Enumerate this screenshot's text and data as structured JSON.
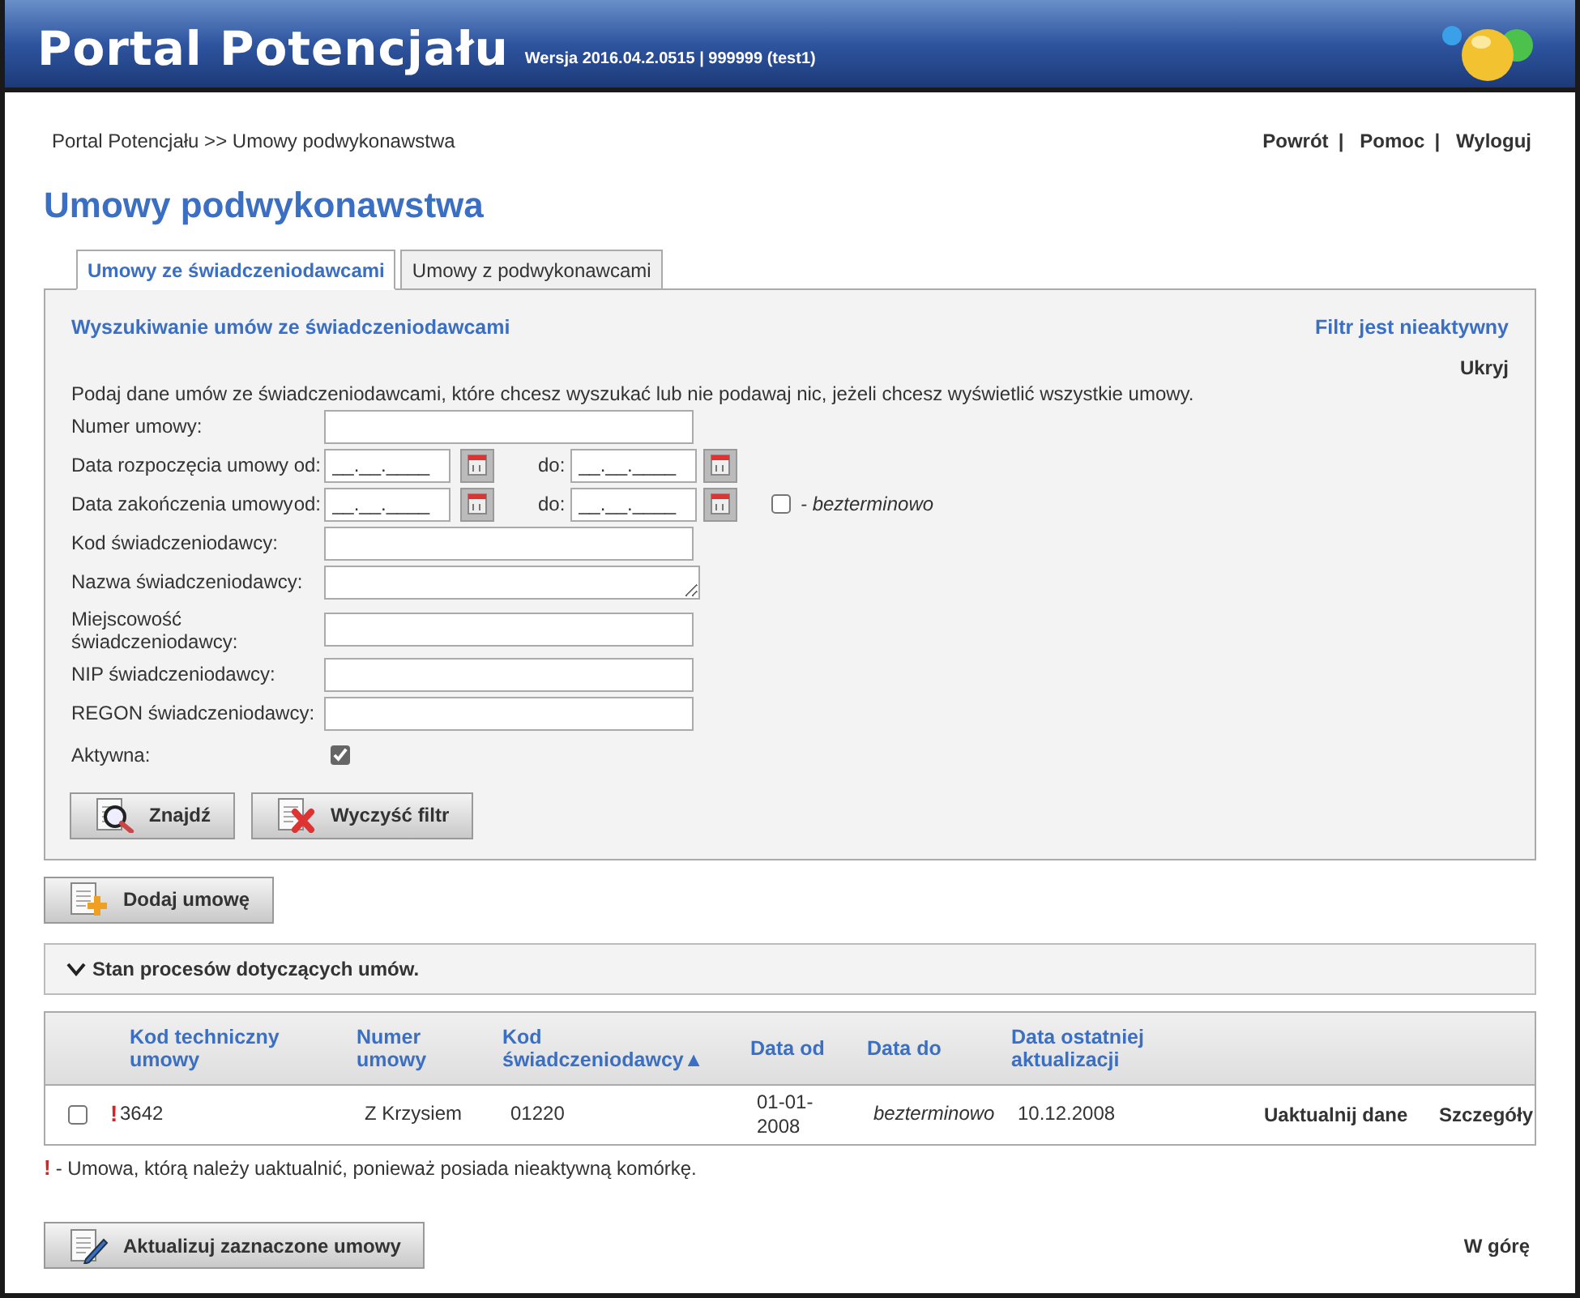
{
  "header": {
    "title": "Portal Potencjału",
    "version": "Wersja 2016.04.2.0515 | 999999 (test1)"
  },
  "breadcrumb": "Portal Potencjału >> Umowy podwykonawstwa",
  "top_links": [
    {
      "label": "Powrót",
      "separator": "|"
    },
    {
      "label": "Pomoc",
      "separator": "|"
    },
    {
      "label": "Wyloguj"
    }
  ],
  "page_title": "Umowy podwykonawstwa",
  "tabs": [
    {
      "label": "Umowy ze świadczeniodawcami",
      "selected": true
    },
    {
      "label": "Umowy z podwykonawcami",
      "selected": false
    }
  ],
  "filter": {
    "title": "Wyszukiwanie umów ze świadczeniodawcami",
    "status": "Filtr jest nieaktywny",
    "hide_link": "Ukryj",
    "instructions": "Podaj dane umów ze świadczeniodawcami, które chcesz wyszukać lub nie podawaj nic, jeżeli chcesz wyświetlić wszystkie umowy.",
    "fields": [
      {
        "kind": "text",
        "label": "Numer umowy:"
      },
      {
        "kind": "date_range",
        "label": "Data rozpoczęcia umowy",
        "from_label": "od:",
        "from_value": "__.__.____",
        "to_label": "do:",
        "to_value": "__.__.____"
      },
      {
        "kind": "date_range",
        "label": "Data zakończenia umowy",
        "from_label": "od:",
        "from_value": "__.__.____",
        "to_label": "do:",
        "to_value": "__.__.____",
        "open_ended": {
          "label": "- bezterminowo",
          "checked": false
        }
      },
      {
        "kind": "text",
        "label": "Kod świadczeniodawcy:"
      },
      {
        "kind": "textarea",
        "label": "Nazwa świadczeniodawcy:"
      },
      {
        "kind": "text",
        "label": "Miejscowość świadczeniodawcy:"
      },
      {
        "kind": "text",
        "label": "NIP świadczeniodawcy:"
      },
      {
        "kind": "text",
        "label": "REGON świadczeniodawcy:"
      },
      {
        "kind": "checkbox",
        "label": "Aktywna:",
        "checked": true
      }
    ],
    "buttons": [
      {
        "kind": "search",
        "label": "Znajdź"
      },
      {
        "kind": "clear",
        "label": "Wyczyść filtr"
      }
    ]
  },
  "add_button": "Dodaj umowę",
  "process_section": {
    "label": "Stan procesów dotyczących umów.",
    "expanded": false
  },
  "table": {
    "columns": [
      {
        "label": "Kod techniczny umowy"
      },
      {
        "label": "Numer umowy"
      },
      {
        "label": "Kod świadczeniodawcy",
        "sort_indicator": "▲"
      },
      {
        "label": "Data od"
      },
      {
        "label": "Data do"
      },
      {
        "label": "Data ostatniej aktualizacji"
      }
    ],
    "rows": [
      {
        "selected": false,
        "warning": "!",
        "cells": [
          "3642",
          "Z Krzysiem",
          "01220",
          "01-01-2008",
          "bezterminowo",
          "10.12.2008"
        ],
        "actions": [
          "Uaktualnij dane",
          "Szczegóły"
        ]
      }
    ]
  },
  "footnote": {
    "mark": "!",
    "text": "- Umowa, którą należy uaktualnić, ponieważ posiada nieaktywną komórkę."
  },
  "update_button": "Aktualizuj zaznaczone umowy",
  "top_link": "W górę"
}
